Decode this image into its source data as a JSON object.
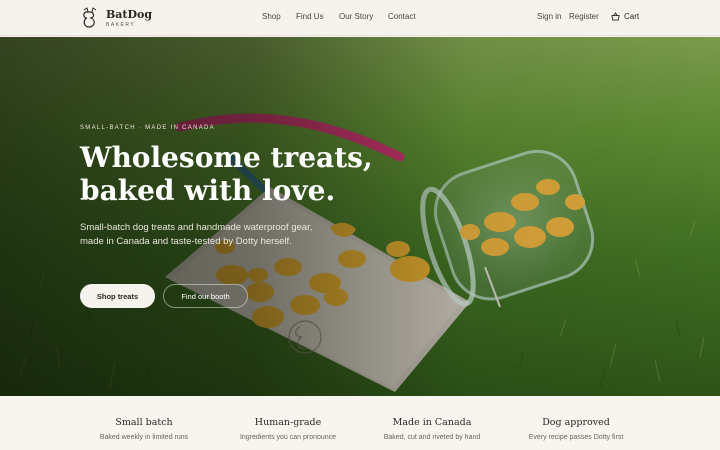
{
  "brand": {
    "name": "BatDog",
    "sub": "BAKERY"
  },
  "nav": {
    "shop": "Shop",
    "find_us": "Find Us",
    "our_story": "Our Story",
    "contact": "Contact"
  },
  "account": {
    "sign_in": "Sign in",
    "register": "Register",
    "cart": "Cart"
  },
  "hero": {
    "eyebrow": "SMALL-BATCH · MADE IN CANADA",
    "headline_line1": "Wholesome treats,",
    "headline_line2": "baked with love.",
    "subtext": "Small-batch dog treats and handmade waterproof gear, made in Canada and taste-tested by Dotty herself.",
    "cta_primary": "Shop treats",
    "cta_secondary": "Find our booth"
  },
  "features": [
    {
      "title": "Small batch",
      "desc": "Baked weekly in limited runs"
    },
    {
      "title": "Human-grade",
      "desc": "Ingredients you can pronounce"
    },
    {
      "title": "Made in Canada",
      "desc": "Baked, cut and riveted by hand"
    },
    {
      "title": "Dog approved",
      "desc": "Every recipe passes Dotty first"
    }
  ],
  "colors": {
    "cream": "#f6f3ee",
    "ink": "#2b2622",
    "grass": "#3d6a22"
  },
  "icons": {
    "logo": "batdog-logo-icon",
    "cart": "basket-icon"
  }
}
